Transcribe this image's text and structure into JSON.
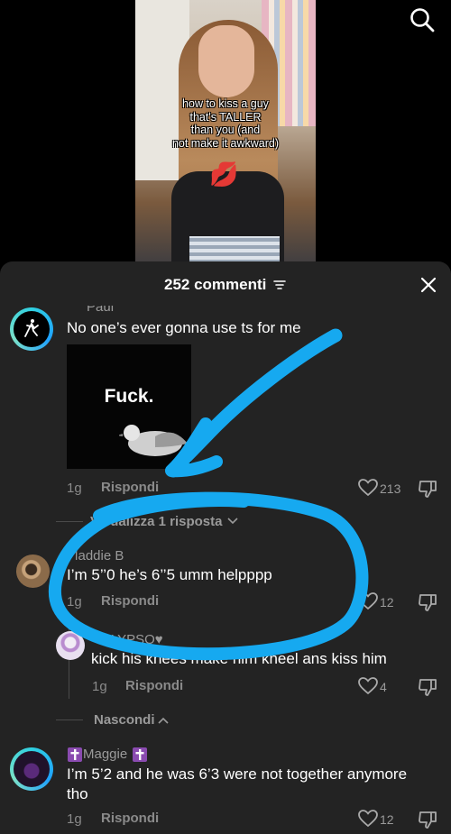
{
  "video": {
    "caption_lines": [
      "how to kiss a guy",
      "that's TALLER",
      "than you (and",
      "not make it awkward)"
    ],
    "emoji": "💋"
  },
  "sheet": {
    "title": "252 commenti",
    "close_icon": "close-icon",
    "filter_icon": "filter-icon"
  },
  "comments": [
    {
      "name": "Paul",
      "text": "No one’s ever gonna use ts for me",
      "image_text": "Fuck.",
      "time": "1g",
      "reply_label": "Rispondi",
      "likes": "213"
    },
    {
      "name": "Maddie B",
      "text": "I’m 5’’0 he’s 6’’5 umm helpppp",
      "time": "1g",
      "reply_label": "Rispondi",
      "likes": "12"
    },
    {
      "name": "Maggie",
      "text_line1": "I’m 5’2 and he was 6’3 were not together anymore",
      "text_line2": "tho",
      "time": "1g",
      "reply_label": "Rispondi",
      "likes": "12"
    }
  ],
  "replies": [
    {
      "name": "CALYPSO♥",
      "text": "kick his knees make him kneel ans kiss him",
      "time": "1g",
      "reply_label": "Rispondi",
      "likes": "4"
    }
  ],
  "view_replies_label": "Visualizza 1 risposta",
  "hide_label": "Nascondi",
  "colors": {
    "sheet_bg": "#232323",
    "scribble": "#16a9f0",
    "secondary_text": "#8a8a8a"
  }
}
